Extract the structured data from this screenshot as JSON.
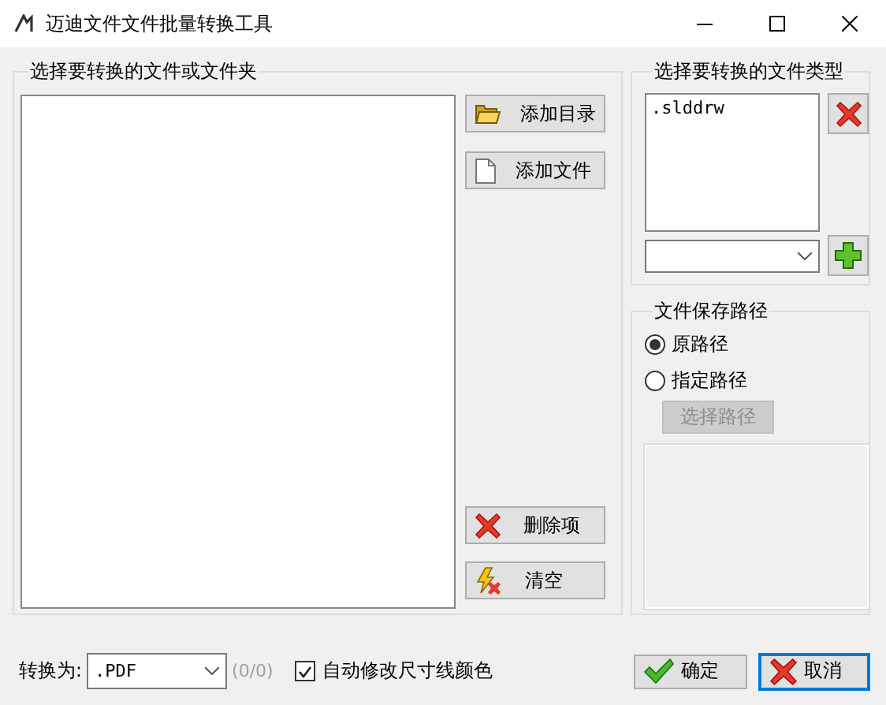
{
  "window": {
    "title": "迈迪文件文件批量转换工具"
  },
  "source_group": {
    "title": "选择要转换的文件或文件夹",
    "buttons": [
      {
        "label": "添加目录",
        "kind": "folder"
      },
      {
        "label": "添加文件",
        "kind": "file"
      },
      {
        "label": "删除项",
        "kind": "delete"
      },
      {
        "label": "清空",
        "kind": "clear"
      }
    ]
  },
  "type_group": {
    "title": "选择要转换的文件类型",
    "items": [
      {
        "label": ".slddrw",
        "selected": false
      }
    ]
  },
  "save_group": {
    "title": "文件保存路径",
    "options": [
      {
        "label": "原路径",
        "selected": true
      },
      {
        "label": "指定路径",
        "selected": false
      }
    ],
    "choose_button": {
      "label": "选择路径",
      "disabled": true
    }
  },
  "bottom": {
    "convert_label": "转换为:",
    "format": ".PDF",
    "count": "(0/0)",
    "auto_color": {
      "label": "自动修改尺寸线颜色",
      "checked": true
    }
  },
  "buttons": [
    {
      "label": "确定",
      "kind": "ok",
      "focused": false
    },
    {
      "label": "取消",
      "kind": "cancel",
      "focused": true
    }
  ]
}
